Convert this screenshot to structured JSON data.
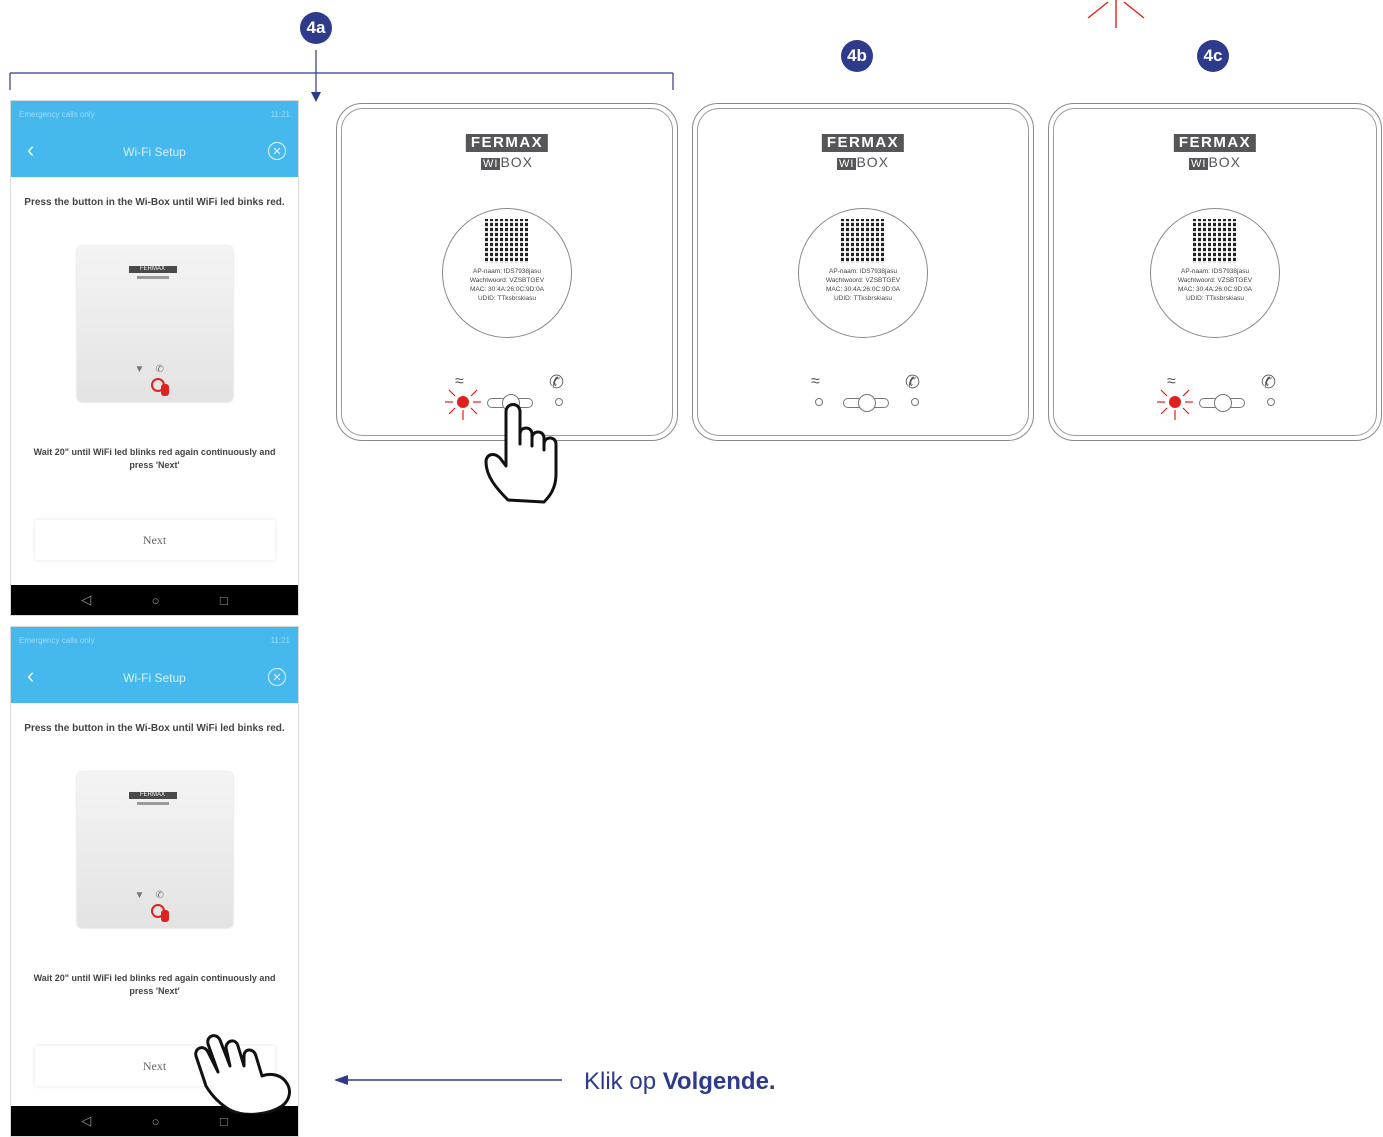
{
  "steps": {
    "a": "4a",
    "b": "4b",
    "c": "4c"
  },
  "phone": {
    "status_left": "Emergency calls only",
    "status_right": "11:21",
    "title": "Wi-Fi Setup",
    "instruction": "Press the button in the Wi-Box until WiFi led binks red.",
    "mini_logo": "FERMAX",
    "wait_text": "Wait 20\" until WiFi led blinks red again continuously and press 'Next'",
    "next_label": "Next"
  },
  "device": {
    "brand": "FERMAX",
    "model_prefix": "WI",
    "model_suffix": "BOX",
    "label_lines": [
      "AP-naam: IDS7938jasu",
      "Wachtwoord: VZSBTGEV",
      "MAC: 30:4A:26:0C:9D:0A",
      "UDID: TTksbrskiasu"
    ]
  },
  "caption": {
    "prefix": "Klik op ",
    "bold": "Volgende."
  },
  "colors": {
    "badge": "#2e3a8c",
    "app_blue": "#45b8ee",
    "led_red": "#e0201c"
  }
}
